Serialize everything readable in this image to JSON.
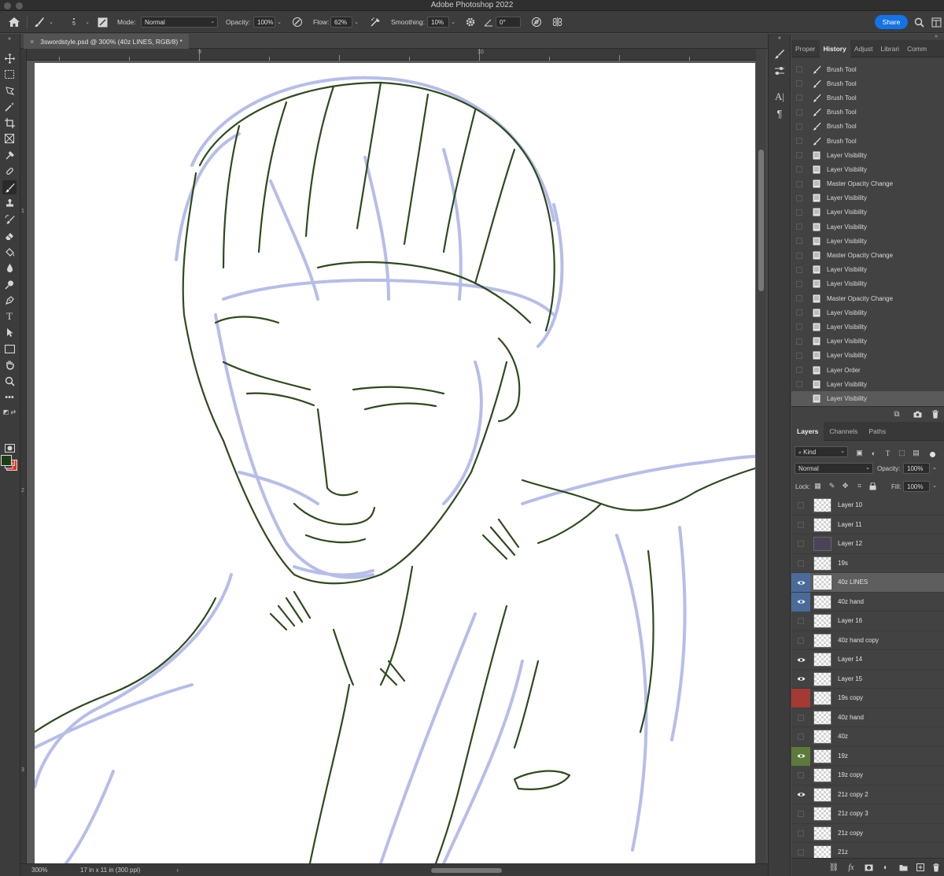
{
  "window": {
    "title": "Adobe Photoshop 2022"
  },
  "options_bar": {
    "brush_size": "5",
    "mode_label": "Mode:",
    "mode_value": "Normal",
    "opacity_label": "Opacity:",
    "opacity_value": "100%",
    "flow_label": "Flow:",
    "flow_value": "62%",
    "smoothing_label": "Smoothing:",
    "smoothing_value": "10%",
    "angle_value": "0°",
    "share_label": "Share"
  },
  "document": {
    "tab_title": "3swordstyle.psd @ 300% (40z LINES, RGB/8) *",
    "ruler_top": [
      "9",
      "10"
    ],
    "ruler_left": [
      "1",
      "2",
      "3"
    ]
  },
  "status": {
    "zoom": "300%",
    "doc_info": "17 in x 11 in (300 ppi)"
  },
  "colors": {
    "foreground": "#1f3d12",
    "background": "#e63222",
    "accent": "#1473e6",
    "sketch_lines": "#2e4a1e",
    "sketch_underlay": "#aab2e6"
  },
  "history_panel": {
    "tabs": [
      "Proper",
      "History",
      "Adjust",
      "Librari",
      "Comm"
    ],
    "active_tab": "History",
    "items": [
      {
        "label": "Brush Tool",
        "icon": "brush-icon"
      },
      {
        "label": "Brush Tool",
        "icon": "brush-icon"
      },
      {
        "label": "Brush Tool",
        "icon": "brush-icon"
      },
      {
        "label": "Brush Tool",
        "icon": "brush-icon"
      },
      {
        "label": "Brush Tool",
        "icon": "brush-icon"
      },
      {
        "label": "Brush Tool",
        "icon": "brush-icon"
      },
      {
        "label": "Layer Visibility",
        "icon": "document-icon"
      },
      {
        "label": "Layer Visibility",
        "icon": "document-icon"
      },
      {
        "label": "Master Opacity Change",
        "icon": "document-icon"
      },
      {
        "label": "Layer Visibility",
        "icon": "document-icon"
      },
      {
        "label": "Layer Visibility",
        "icon": "document-icon"
      },
      {
        "label": "Layer Visibility",
        "icon": "document-icon"
      },
      {
        "label": "Layer Visibility",
        "icon": "document-icon"
      },
      {
        "label": "Master Opacity Change",
        "icon": "document-icon"
      },
      {
        "label": "Layer Visibility",
        "icon": "document-icon"
      },
      {
        "label": "Layer Visibility",
        "icon": "document-icon"
      },
      {
        "label": "Master Opacity Change",
        "icon": "document-icon"
      },
      {
        "label": "Layer Visibility",
        "icon": "document-icon"
      },
      {
        "label": "Layer Visibility",
        "icon": "document-icon"
      },
      {
        "label": "Layer Visibility",
        "icon": "document-icon"
      },
      {
        "label": "Layer Visibility",
        "icon": "document-icon"
      },
      {
        "label": "Layer Order",
        "icon": "document-icon"
      },
      {
        "label": "Layer Visibility",
        "icon": "document-icon"
      },
      {
        "label": "Layer Visibility",
        "icon": "document-icon"
      }
    ]
  },
  "layers_panel": {
    "tabs": [
      "Layers",
      "Channels",
      "Paths"
    ],
    "active_tab": "Layers",
    "filter_label": "Kind",
    "blend_mode": "Normal",
    "opacity_label": "Opacity:",
    "opacity_value": "100%",
    "lock_label": "Lock:",
    "fill_label": "Fill:",
    "fill_value": "100%",
    "layers": [
      {
        "name": "Layer 10",
        "visible": false,
        "tag": ""
      },
      {
        "name": "Layer 11",
        "visible": false,
        "tag": ""
      },
      {
        "name": "Layer 12",
        "visible": false,
        "tag": "",
        "thumb": "dark"
      },
      {
        "name": "19s",
        "visible": false,
        "tag": ""
      },
      {
        "name": "40z LINES",
        "visible": true,
        "tag": "#4a6a9a",
        "selected": true
      },
      {
        "name": "40z hand",
        "visible": true,
        "tag": "#4a6a9a"
      },
      {
        "name": "Layer 16",
        "visible": false,
        "tag": ""
      },
      {
        "name": "40z hand copy",
        "visible": false,
        "tag": ""
      },
      {
        "name": "Layer 14",
        "visible": true,
        "tag": ""
      },
      {
        "name": "Layer 15",
        "visible": true,
        "tag": ""
      },
      {
        "name": "19s copy",
        "visible": false,
        "tag": "#a33a33"
      },
      {
        "name": "40z hand",
        "visible": false,
        "tag": ""
      },
      {
        "name": "40z",
        "visible": false,
        "tag": ""
      },
      {
        "name": "19z",
        "visible": true,
        "tag": "#5d7a3c"
      },
      {
        "name": "19z copy",
        "visible": false,
        "tag": ""
      },
      {
        "name": "21z copy 2",
        "visible": true,
        "tag": ""
      },
      {
        "name": "21z copy 3",
        "visible": false,
        "tag": ""
      },
      {
        "name": "21z copy",
        "visible": false,
        "tag": ""
      },
      {
        "name": "21z",
        "visible": false,
        "tag": ""
      }
    ]
  }
}
